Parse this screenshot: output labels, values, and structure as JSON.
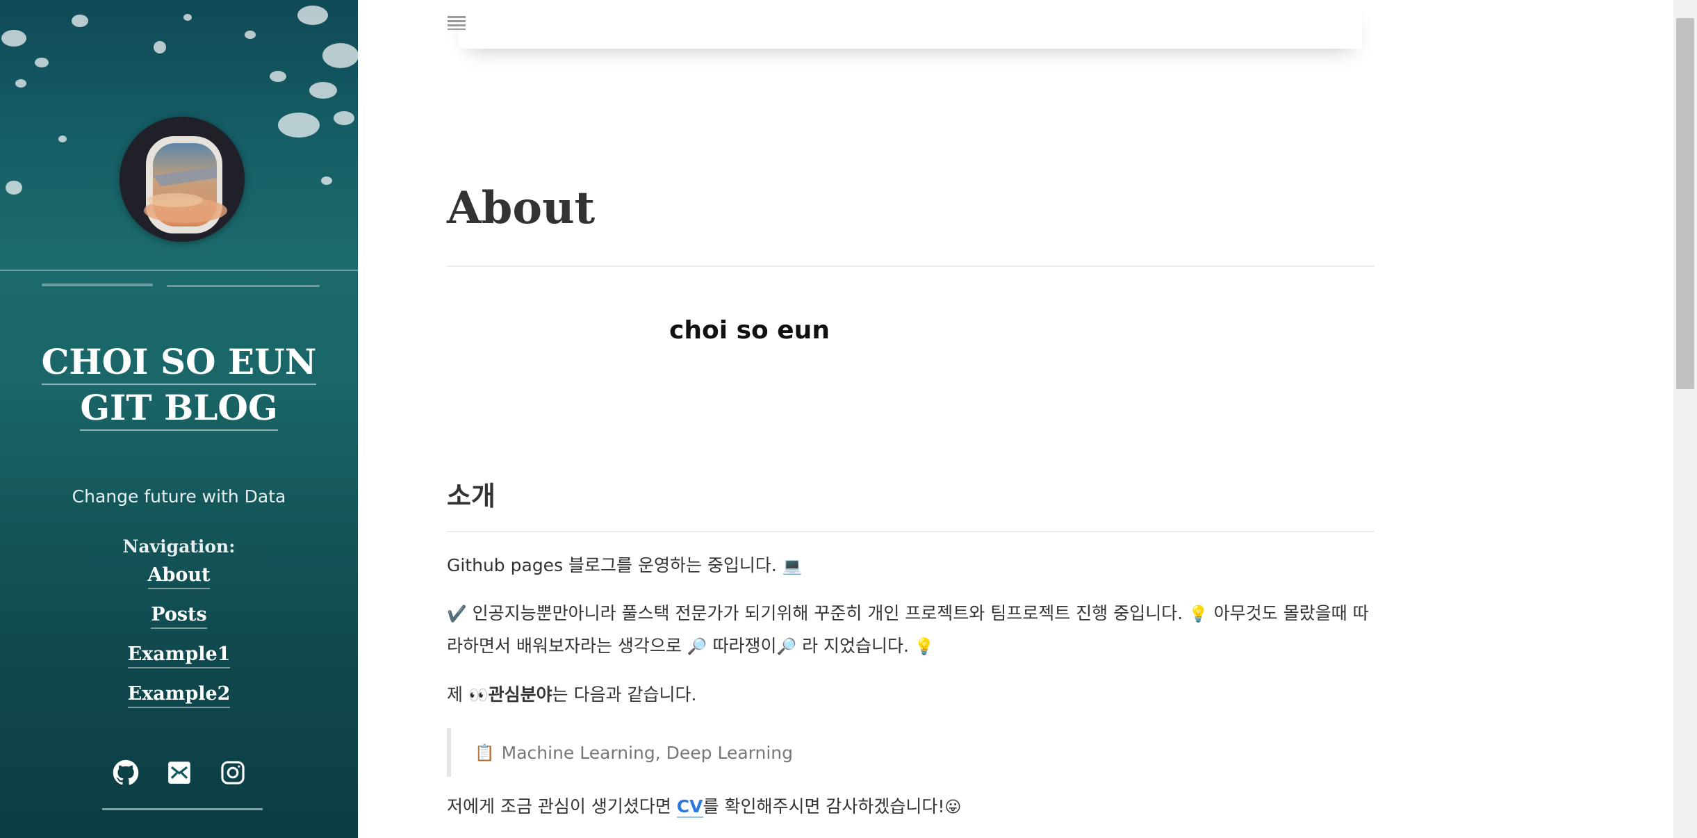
{
  "sidebar": {
    "title": "CHOI SO EUN GIT BLOG",
    "tagline": "Change future with Data",
    "nav_heading": "Navigation:",
    "nav_items": [
      {
        "label": "About"
      },
      {
        "label": "Posts"
      },
      {
        "label": "Example1"
      },
      {
        "label": "Example2"
      }
    ],
    "social_icons": [
      "github-icon",
      "email-icon",
      "instagram-icon"
    ]
  },
  "topbar": {
    "menu_icon": "menu-icon"
  },
  "main": {
    "page_title": "About",
    "name": "choi so eun",
    "section_title": "소개",
    "para1": "Github pages 블로그를 운영하는 중입니다.",
    "para1_emoji": "💻",
    "para2_check": "✔️",
    "para2_a": "인공지능뿐만아니라 풀스택 전문가가 되기위해 꾸준히 개인 프로젝트와 팀프로젝트 진행 중입니다.",
    "para2_emoji1": "💡",
    "para2_b": "아무것도 몰랐을때 따라하면서 배워보자라는 생각으로",
    "para2_emoji2": "🔎",
    "para2_c": "따라쟁이",
    "para2_emoji3": "🔎",
    "para2_d": "라 지었습니다.",
    "para2_emoji4": "💡",
    "para3_a": "제",
    "para3_emoji": "👀",
    "para3_bold": "관심분야",
    "para3_b": "는 다음과 같습니다.",
    "quote_emoji": "📋",
    "quote_text": "Machine Learning, Deep Learning",
    "para4_a": "저에게 조금 관심이 생기셨다면",
    "para4_link": "CV",
    "para4_b": "를 확인해주시면 감사하겠습니다!",
    "para4_emoji": "😛"
  },
  "colors": {
    "sidebar_bg": "#165f66",
    "link": "#2a7ae2",
    "text": "#333333"
  }
}
